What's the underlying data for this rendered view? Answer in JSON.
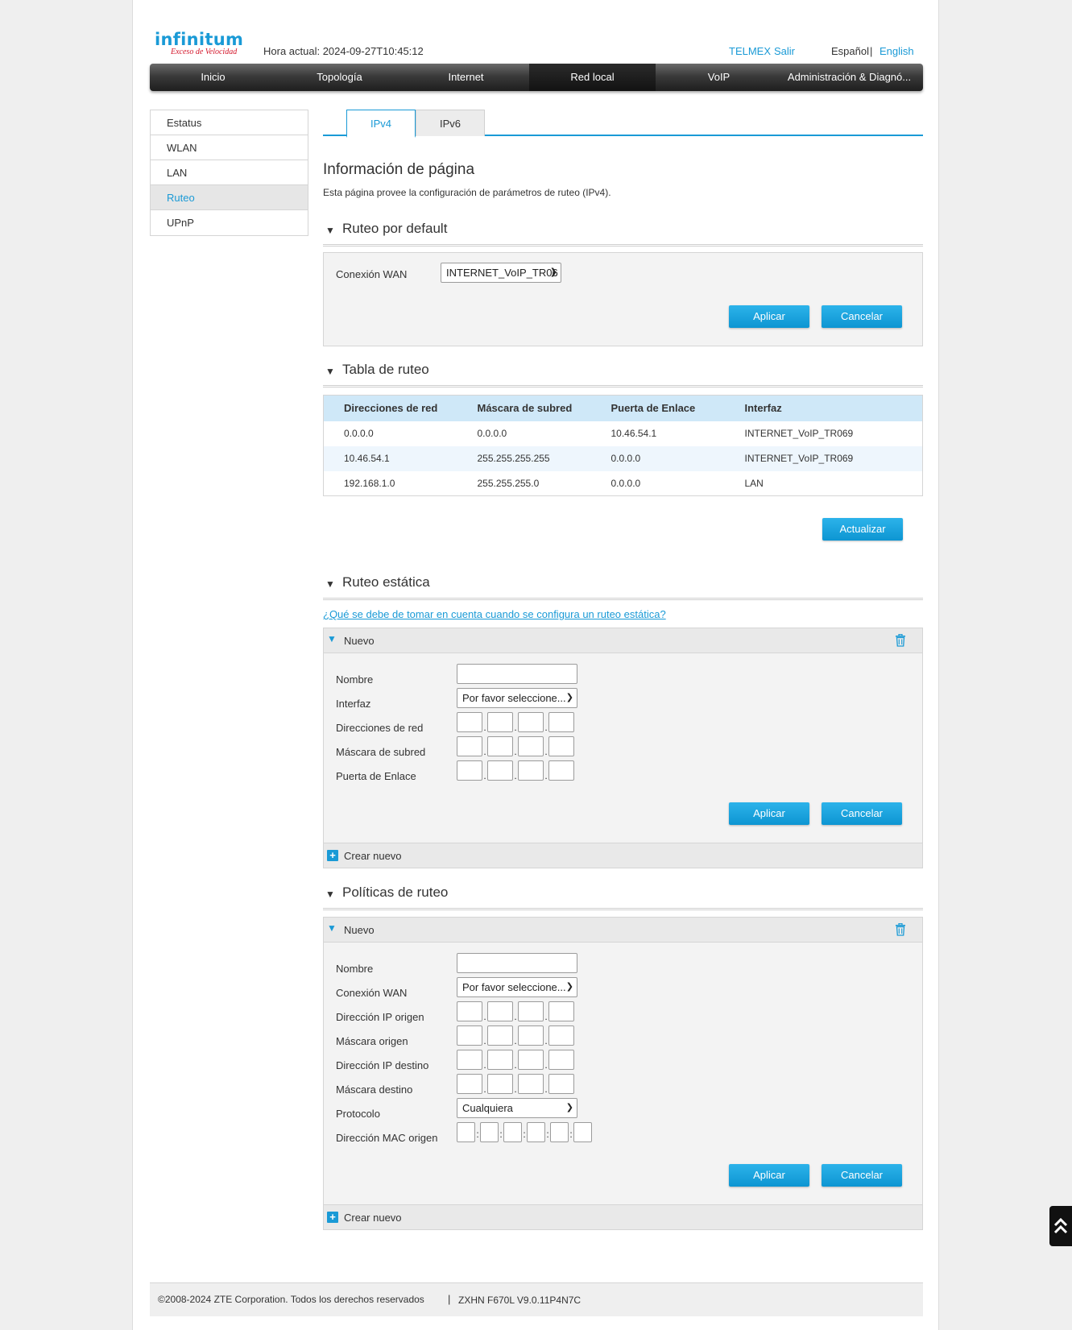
{
  "header": {
    "logo_main": "infinitum",
    "logo_sub": "Exceso de Velocidad",
    "hora_label": "Hora actual: 2024-09-27T10:45:12",
    "link_telmex": "TELMEX",
    "link_salir": "Salir",
    "lang_espanol": "Español",
    "lang_sep": "|",
    "lang_english": "English"
  },
  "nav": [
    "Inicio",
    "Topología",
    "Internet",
    "Red local",
    "VoIP",
    "Administración & Diagnó..."
  ],
  "sidebar": [
    "Estatus",
    "WLAN",
    "LAN",
    "Ruteo",
    "UPnP"
  ],
  "tabs": [
    "IPv4",
    "IPv6"
  ],
  "page": {
    "title": "Información de página",
    "desc": "Esta página provee la configuración de parámetros de ruteo (IPv4)."
  },
  "default_route": {
    "heading": "Ruteo por default",
    "wan_label": "Conexión WAN",
    "wan_value": "INTERNET_VoIP_TR06",
    "apply": "Aplicar",
    "cancel": "Cancelar"
  },
  "route_table": {
    "heading": "Tabla de ruteo",
    "columns": [
      "Direcciones de red",
      "Máscara de subred",
      "Puerta de Enlace",
      "Interfaz"
    ],
    "rows": [
      [
        "0.0.0.0",
        "0.0.0.0",
        "10.46.54.1",
        "INTERNET_VoIP_TR069"
      ],
      [
        "10.46.54.1",
        "255.255.255.255",
        "0.0.0.0",
        "INTERNET_VoIP_TR069"
      ],
      [
        "192.168.1.0",
        "255.255.255.0",
        "0.0.0.0",
        "LAN"
      ]
    ],
    "refresh": "Actualizar"
  },
  "static_route": {
    "heading": "Ruteo estática",
    "help_link": "¿Qué se debe de tomar en cuenta cuando se configura un ruteo estática?",
    "new_label": "Nuevo",
    "name_label": "Nombre",
    "iface_label": "Interfaz",
    "iface_value": "Por favor seleccione...",
    "net_label": "Direcciones de red",
    "mask_label": "Máscara de subred",
    "gw_label": "Puerta de Enlace",
    "apply": "Aplicar",
    "cancel": "Cancelar",
    "create_new": "Crear nuevo"
  },
  "policy_route": {
    "heading": "Políticas de ruteo",
    "new_label": "Nuevo",
    "name_label": "Nombre",
    "wan_label": "Conexión WAN",
    "wan_value": "Por favor seleccione...",
    "src_ip_label": "Dirección IP origen",
    "src_mask_label": "Máscara origen",
    "dst_ip_label": "Dirección IP destino",
    "dst_mask_label": "Máscara destino",
    "proto_label": "Protocolo",
    "proto_value": "Cualquiera",
    "mac_label": "Dirección MAC origen",
    "apply": "Aplicar",
    "cancel": "Cancelar",
    "create_new": "Crear nuevo"
  },
  "footer": {
    "copyright": "©2008-2024 ZTE Corporation. Todos los derechos reservados",
    "sep": "|",
    "model": "ZXHN F670L V9.0.11P4N7C"
  },
  "colors": {
    "accent": "#1a9ad6",
    "logo_red": "#d3162a",
    "table_header": "#cfe8f8"
  }
}
